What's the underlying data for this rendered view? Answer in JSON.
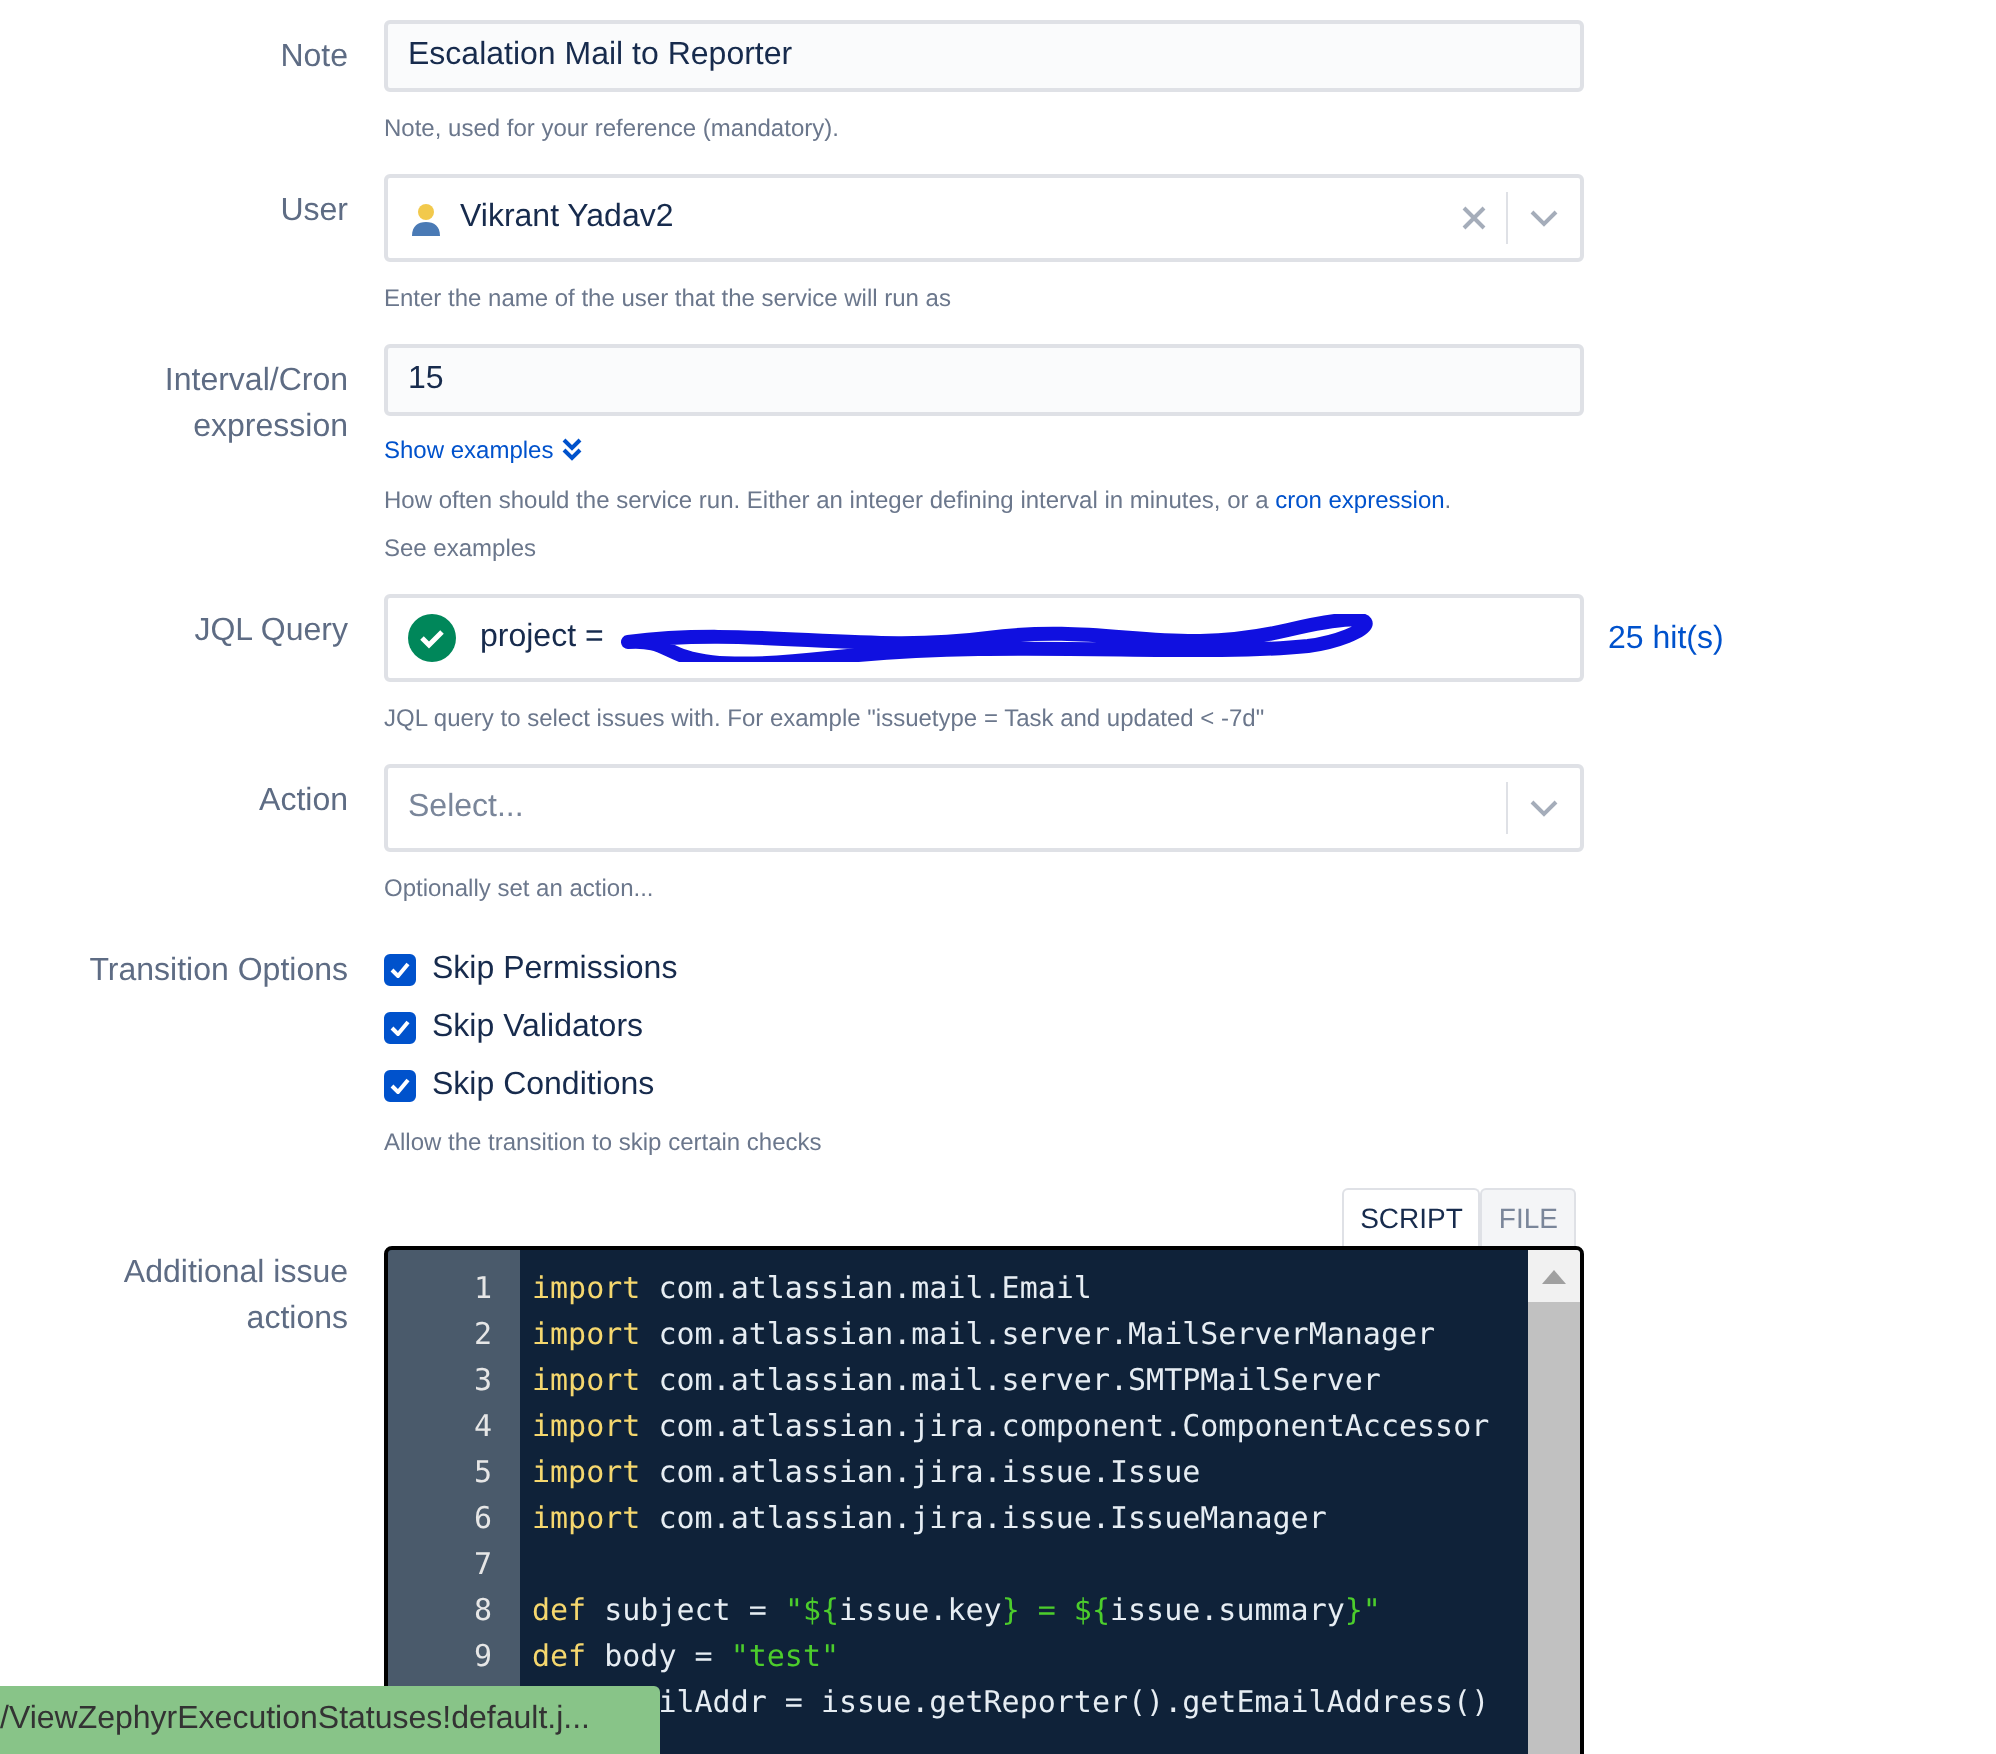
{
  "fields": [
    {
      "kind": "text",
      "label": "Note",
      "value": "Escalation Mail to Reporter",
      "help": [
        "Note, used for your reference (mandatory)."
      ]
    },
    {
      "kind": "user",
      "label": "User",
      "value": "Vikrant Yadav2",
      "help": [
        "Enter the name of the user that the service will run as"
      ]
    },
    {
      "kind": "interval",
      "label": "Interval/Cron expression",
      "value": "15",
      "toggle": "Show examples",
      "help": [
        "How often should the service run. Either an integer defining interval in minutes, or a ",
        "See examples"
      ],
      "link": "cron expression",
      "link_tail": "."
    },
    {
      "kind": "jql",
      "label": "JQL Query",
      "value": "project = ",
      "valid": true,
      "hits": "25 hit(s)",
      "help": [
        "JQL query to select issues with. For example \"issuetype = Task and updated < -7d\""
      ]
    },
    {
      "kind": "select",
      "label": "Action",
      "placeholder": "Select...",
      "help": [
        "Optionally set an action..."
      ]
    },
    {
      "kind": "checks",
      "label": "Transition Options",
      "options": [
        {
          "label": "Skip Permissions",
          "checked": true
        },
        {
          "label": "Skip Validators",
          "checked": true
        },
        {
          "label": "Skip Conditions",
          "checked": true
        }
      ],
      "help": [
        "Allow the transition to skip certain checks"
      ]
    },
    {
      "kind": "code",
      "label": "Additional issue actions",
      "tabs": [
        {
          "label": "SCRIPT",
          "selected": true
        },
        {
          "label": "FILE",
          "selected": false
        }
      ],
      "lines": [
        {
          "number": "1",
          "tokens": [
            {
              "kind": "keyword",
              "text": "import"
            },
            {
              "kind": "plain",
              "text": " com.atlassian.mail.Email"
            }
          ]
        },
        {
          "number": "2",
          "tokens": [
            {
              "kind": "keyword",
              "text": "import"
            },
            {
              "kind": "plain",
              "text": " com.atlassian.mail.server.MailServerManager"
            }
          ]
        },
        {
          "number": "3",
          "tokens": [
            {
              "kind": "keyword",
              "text": "import"
            },
            {
              "kind": "plain",
              "text": " com.atlassian.mail.server.SMTPMailServer"
            }
          ]
        },
        {
          "number": "4",
          "tokens": [
            {
              "kind": "keyword",
              "text": "import"
            },
            {
              "kind": "plain",
              "text": " com.atlassian.jira.component.ComponentAccessor"
            }
          ]
        },
        {
          "number": "5",
          "tokens": [
            {
              "kind": "keyword",
              "text": "import"
            },
            {
              "kind": "plain",
              "text": " com.atlassian.jira.issue.Issue"
            }
          ]
        },
        {
          "number": "6",
          "tokens": [
            {
              "kind": "keyword",
              "text": "import"
            },
            {
              "kind": "plain",
              "text": " com.atlassian.jira.issue.IssueManager"
            }
          ]
        },
        {
          "number": "7"
        },
        {
          "number": "8",
          "tokens": [
            {
              "kind": "keyword",
              "text": "def"
            },
            {
              "kind": "plain",
              "text": " subject = "
            },
            {
              "kind": "string",
              "text": "\"${"
            },
            {
              "kind": "plain",
              "text": "issue.key"
            },
            {
              "kind": "string",
              "text": "} = ${"
            },
            {
              "kind": "plain",
              "text": "issue.summary"
            },
            {
              "kind": "string",
              "text": "}\""
            }
          ]
        },
        {
          "number": "9",
          "tokens": [
            {
              "kind": "keyword",
              "text": "def"
            },
            {
              "kind": "plain",
              "text": " body = "
            },
            {
              "kind": "string",
              "text": "\"test\""
            }
          ]
        },
        {
          "tokens": [
            {
              "kind": "plain",
              "text": "ilAddr = issue.getReporter().getEmailAddress()"
            }
          ]
        }
      ]
    }
  ],
  "status_bar": {
    "text": "/ViewZephyrExecutionStatuses!default.j..."
  }
}
